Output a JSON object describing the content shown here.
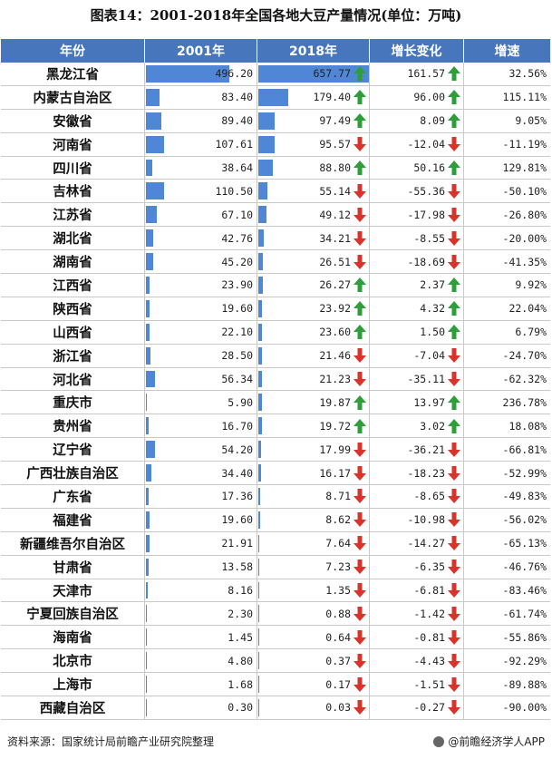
{
  "title": "图表14：2001-2018年全国各地大豆产量情况(单位：万吨)",
  "headers": [
    "年份",
    "2001年",
    "2018年",
    "增长变化",
    "增速"
  ],
  "footer_source": "资料来源：国家统计局前瞻产业研究院整理",
  "footer_brand": "@前瞻经济学人APP",
  "colors": {
    "header_bg": "#4776bc",
    "bar": "#4f86d6",
    "up": "#2e9e3a",
    "down": "#d9342b"
  },
  "bar_max": 657.77,
  "rows": [
    {
      "province": "黑龙江省",
      "v2001": "496.20",
      "v2018": "657.77",
      "change": "161.57",
      "rate": "32.56%",
      "dir": "up"
    },
    {
      "province": "内蒙古自治区",
      "v2001": "83.40",
      "v2018": "179.40",
      "change": "96.00",
      "rate": "115.11%",
      "dir": "up"
    },
    {
      "province": "安徽省",
      "v2001": "89.40",
      "v2018": "97.49",
      "change": "8.09",
      "rate": "9.05%",
      "dir": "up"
    },
    {
      "province": "河南省",
      "v2001": "107.61",
      "v2018": "95.57",
      "change": "-12.04",
      "rate": "-11.19%",
      "dir": "down"
    },
    {
      "province": "四川省",
      "v2001": "38.64",
      "v2018": "88.80",
      "change": "50.16",
      "rate": "129.81%",
      "dir": "up"
    },
    {
      "province": "吉林省",
      "v2001": "110.50",
      "v2018": "55.14",
      "change": "-55.36",
      "rate": "-50.10%",
      "dir": "down"
    },
    {
      "province": "江苏省",
      "v2001": "67.10",
      "v2018": "49.12",
      "change": "-17.98",
      "rate": "-26.80%",
      "dir": "down"
    },
    {
      "province": "湖北省",
      "v2001": "42.76",
      "v2018": "34.21",
      "change": "-8.55",
      "rate": "-20.00%",
      "dir": "down"
    },
    {
      "province": "湖南省",
      "v2001": "45.20",
      "v2018": "26.51",
      "change": "-18.69",
      "rate": "-41.35%",
      "dir": "down"
    },
    {
      "province": "江西省",
      "v2001": "23.90",
      "v2018": "26.27",
      "change": "2.37",
      "rate": "9.92%",
      "dir": "up"
    },
    {
      "province": "陕西省",
      "v2001": "19.60",
      "v2018": "23.92",
      "change": "4.32",
      "rate": "22.04%",
      "dir": "up"
    },
    {
      "province": "山西省",
      "v2001": "22.10",
      "v2018": "23.60",
      "change": "1.50",
      "rate": "6.79%",
      "dir": "up"
    },
    {
      "province": "浙江省",
      "v2001": "28.50",
      "v2018": "21.46",
      "change": "-7.04",
      "rate": "-24.70%",
      "dir": "down"
    },
    {
      "province": "河北省",
      "v2001": "56.34",
      "v2018": "21.23",
      "change": "-35.11",
      "rate": "-62.32%",
      "dir": "down"
    },
    {
      "province": "重庆市",
      "v2001": "5.90",
      "v2018": "19.87",
      "change": "13.97",
      "rate": "236.78%",
      "dir": "up"
    },
    {
      "province": "贵州省",
      "v2001": "16.70",
      "v2018": "19.72",
      "change": "3.02",
      "rate": "18.08%",
      "dir": "up"
    },
    {
      "province": "辽宁省",
      "v2001": "54.20",
      "v2018": "17.99",
      "change": "-36.21",
      "rate": "-66.81%",
      "dir": "down"
    },
    {
      "province": "广西壮族自治区",
      "v2001": "34.40",
      "v2018": "16.17",
      "change": "-18.23",
      "rate": "-52.99%",
      "dir": "down"
    },
    {
      "province": "广东省",
      "v2001": "17.36",
      "v2018": "8.71",
      "change": "-8.65",
      "rate": "-49.83%",
      "dir": "down"
    },
    {
      "province": "福建省",
      "v2001": "19.60",
      "v2018": "8.62",
      "change": "-10.98",
      "rate": "-56.02%",
      "dir": "down"
    },
    {
      "province": "新疆维吾尔自治区",
      "v2001": "21.91",
      "v2018": "7.64",
      "change": "-14.27",
      "rate": "-65.13%",
      "dir": "down"
    },
    {
      "province": "甘肃省",
      "v2001": "13.58",
      "v2018": "7.23",
      "change": "-6.35",
      "rate": "-46.76%",
      "dir": "down"
    },
    {
      "province": "天津市",
      "v2001": "8.16",
      "v2018": "1.35",
      "change": "-6.81",
      "rate": "-83.46%",
      "dir": "down"
    },
    {
      "province": "宁夏回族自治区",
      "v2001": "2.30",
      "v2018": "0.88",
      "change": "-1.42",
      "rate": "-61.74%",
      "dir": "down"
    },
    {
      "province": "海南省",
      "v2001": "1.45",
      "v2018": "0.64",
      "change": "-0.81",
      "rate": "-55.86%",
      "dir": "down"
    },
    {
      "province": "北京市",
      "v2001": "4.80",
      "v2018": "0.37",
      "change": "-4.43",
      "rate": "-92.29%",
      "dir": "down"
    },
    {
      "province": "上海市",
      "v2001": "1.68",
      "v2018": "0.17",
      "change": "-1.51",
      "rate": "-89.88%",
      "dir": "down"
    },
    {
      "province": "西藏自治区",
      "v2001": "0.30",
      "v2018": "0.03",
      "change": "-0.27",
      "rate": "-90.00%",
      "dir": "down"
    }
  ],
  "chart_data": {
    "type": "table",
    "title": "图表14：2001-2018年全国各地大豆产量情况(单位：万吨)",
    "columns": [
      "年份",
      "2001年",
      "2018年",
      "增长变化",
      "增速"
    ],
    "categories": [
      "黑龙江省",
      "内蒙古自治区",
      "安徽省",
      "河南省",
      "四川省",
      "吉林省",
      "江苏省",
      "湖北省",
      "湖南省",
      "江西省",
      "陕西省",
      "山西省",
      "浙江省",
      "河北省",
      "重庆市",
      "贵州省",
      "辽宁省",
      "广西壮族自治区",
      "广东省",
      "福建省",
      "新疆维吾尔自治区",
      "甘肃省",
      "天津市",
      "宁夏回族自治区",
      "海南省",
      "北京市",
      "上海市",
      "西藏自治区"
    ],
    "series": [
      {
        "name": "2001年",
        "values": [
          496.2,
          83.4,
          89.4,
          107.61,
          38.64,
          110.5,
          67.1,
          42.76,
          45.2,
          23.9,
          19.6,
          22.1,
          28.5,
          56.34,
          5.9,
          16.7,
          54.2,
          34.4,
          17.36,
          19.6,
          21.91,
          13.58,
          8.16,
          2.3,
          1.45,
          4.8,
          1.68,
          0.3
        ]
      },
      {
        "name": "2018年",
        "values": [
          657.77,
          179.4,
          97.49,
          95.57,
          88.8,
          55.14,
          49.12,
          34.21,
          26.51,
          26.27,
          23.92,
          23.6,
          21.46,
          21.23,
          19.87,
          19.72,
          17.99,
          16.17,
          8.71,
          8.62,
          7.64,
          7.23,
          1.35,
          0.88,
          0.64,
          0.37,
          0.17,
          0.03
        ]
      },
      {
        "name": "增长变化",
        "values": [
          161.57,
          96.0,
          8.09,
          -12.04,
          50.16,
          -55.36,
          -17.98,
          -8.55,
          -18.69,
          2.37,
          4.32,
          1.5,
          -7.04,
          -35.11,
          13.97,
          3.02,
          -36.21,
          -18.23,
          -8.65,
          -10.98,
          -14.27,
          -6.35,
          -6.81,
          -1.42,
          -0.81,
          -4.43,
          -1.51,
          -0.27
        ]
      },
      {
        "name": "增速",
        "values": [
          32.56,
          115.11,
          9.05,
          -11.19,
          129.81,
          -50.1,
          -26.8,
          -20.0,
          -41.35,
          9.92,
          22.04,
          6.79,
          -24.7,
          -62.32,
          236.78,
          18.08,
          -66.81,
          -52.99,
          -49.83,
          -56.02,
          -65.13,
          -46.76,
          -83.46,
          -61.74,
          -55.86,
          -92.29,
          -89.88,
          -90.0
        ]
      }
    ]
  }
}
